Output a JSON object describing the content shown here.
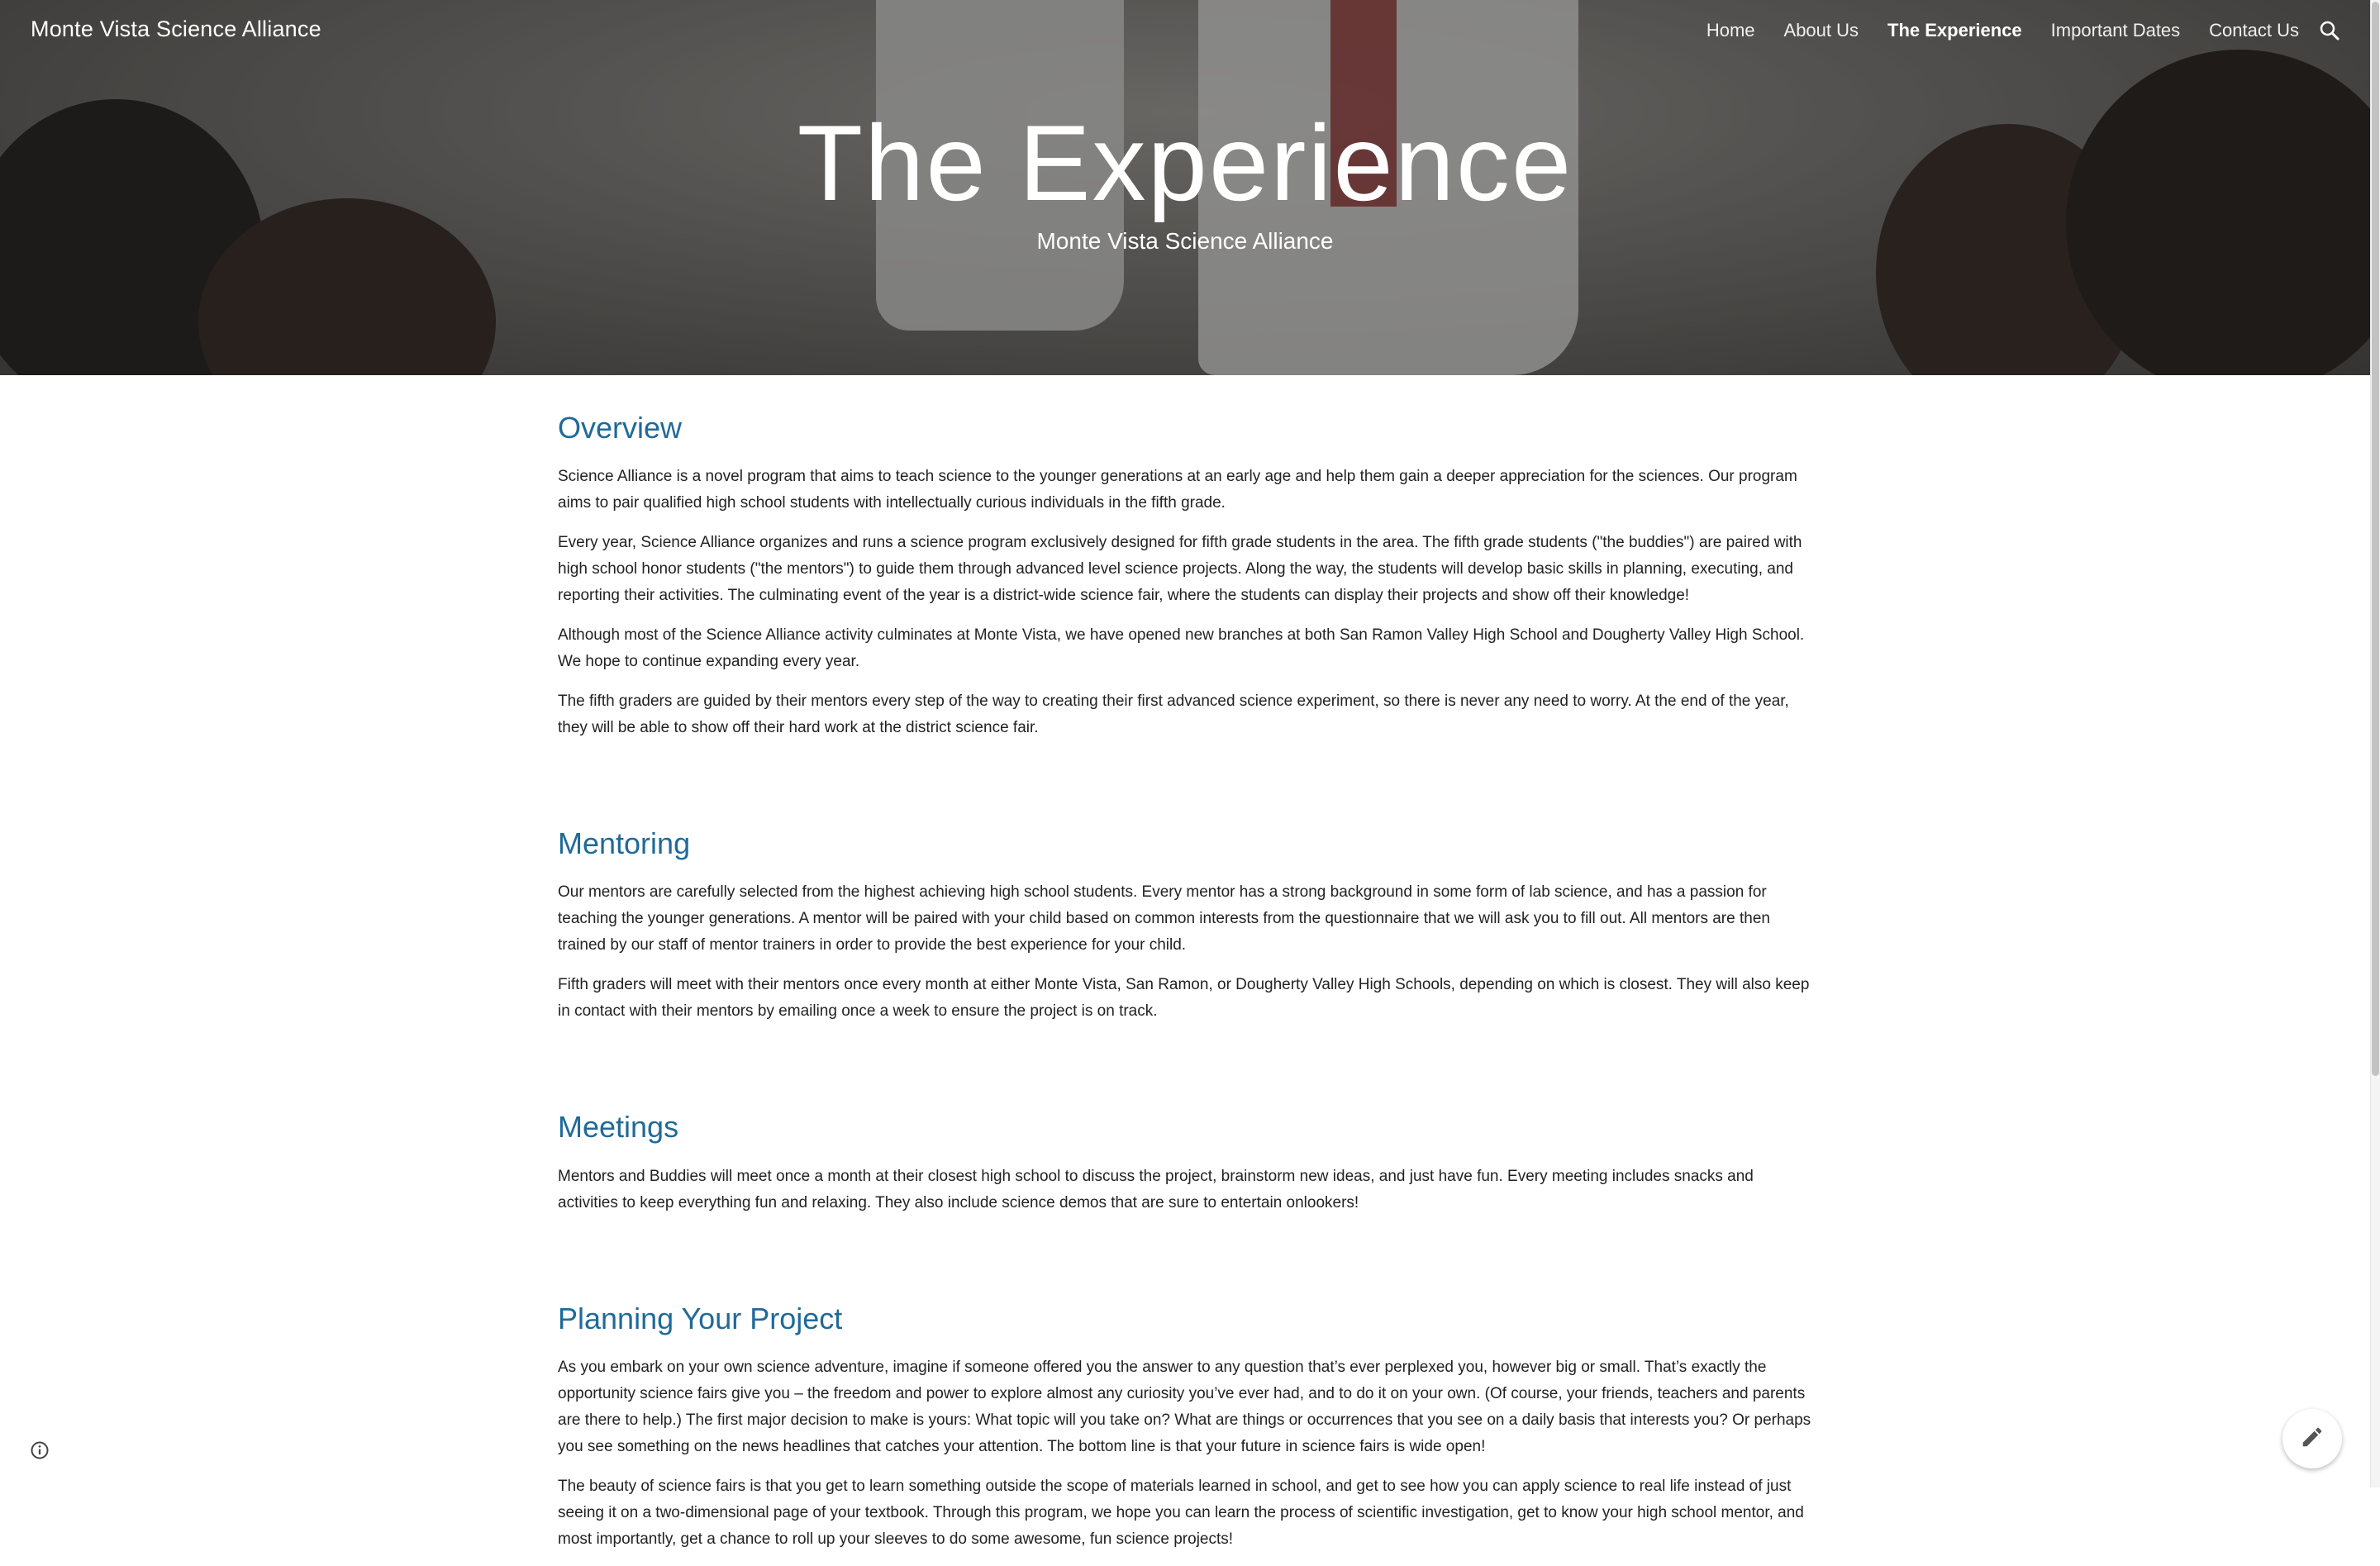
{
  "header": {
    "site_title": "Monte Vista Science Alliance",
    "nav": [
      {
        "label": "Home",
        "active": false
      },
      {
        "label": "About Us",
        "active": false
      },
      {
        "label": "The Experience",
        "active": true
      },
      {
        "label": "Important Dates",
        "active": false
      },
      {
        "label": "Contact Us",
        "active": false
      }
    ],
    "search_icon": "search-icon"
  },
  "hero": {
    "title": "The Experience",
    "subtitle": "Monte Vista Science Alliance"
  },
  "sections": [
    {
      "heading": "Overview",
      "paragraphs": [
        "Science Alliance is a novel program that aims to teach science to the younger generations at an early age and help them gain a deeper appreciation for the sciences. Our program aims to pair qualified high school students with intellectually curious individuals in the fifth grade.",
        "Every year, Science Alliance organizes and runs a science program exclusively designed for fifth grade students in the area. The fifth grade students (\"the buddies\") are paired with high school honor students (\"the mentors\") to guide them through advanced level science projects. Along the way, the students will develop basic skills in planning, executing, and reporting their activities. The culminating event of the year is a district-wide science fair, where the students can display their projects and show off their knowledge!",
        "Although most of the Science Alliance activity culminates at Monte Vista, we have opened new branches at both San Ramon Valley High School and Dougherty Valley High School. We hope to continue expanding every year.",
        "The fifth graders are guided by their mentors every step of the way to creating their first advanced science experiment, so there is never any need to worry. At the end of the year, they will be able to show off their hard work at the district science fair."
      ]
    },
    {
      "heading": "Mentoring",
      "paragraphs": [
        "Our mentors are carefully selected from the highest achieving high school students. Every mentor has a strong background in some form of lab science, and has a passion for teaching the younger generations. A mentor will be paired with your child based on common interests from the questionnaire that we will ask you to fill out. All mentors are then trained by our staff of mentor trainers in order to provide the best experience for your child.",
        "Fifth graders will meet with their mentors once every month at either Monte Vista, San Ramon, or Dougherty Valley High Schools, depending on which is closest. They will also keep in contact with their mentors by emailing once a week to ensure the project is on track."
      ]
    },
    {
      "heading": "Meetings",
      "paragraphs": [
        "Mentors and Buddies will meet once a month at their closest high school to discuss the project, brainstorm new ideas, and just have fun. Every meeting includes snacks and activities to keep everything fun and relaxing. They also include science demos that are sure to entertain onlookers!"
      ]
    },
    {
      "heading": "Planning Your Project",
      "paragraphs": [
        "As you embark on your own science adventure, imagine if someone offered you the answer to any question that’s ever perplexed you, however big or small. That’s exactly the opportunity science fairs give you – the freedom and power to explore almost any curiosity you’ve ever had, and to do it on your own. (Of course, your friends, teachers and parents are there to help.) The first major decision to make is yours: What topic will you take on? What are things or occurrences that you see on a daily basis that interests you? Or perhaps you see something on the news headlines that catches your attention. The bottom line is that your future in science fairs is wide open!",
        "The beauty of science fairs is that you get to learn something outside the scope of materials learned in school, and get to see how you can apply science to real life instead of just seeing it on a two-dimensional page of your textbook. Through this program, we hope you can learn the process of scientific investigation, get to know your high school mentor, and most importantly, get a chance to roll up your sleeves to do some awesome, fun science projects!"
      ]
    }
  ],
  "floating": {
    "edit_icon": "pencil-icon",
    "info_icon": "info-icon"
  },
  "colors": {
    "heading": "#1f6a99",
    "body_text": "#222222",
    "nav_text": "#ffffff"
  }
}
